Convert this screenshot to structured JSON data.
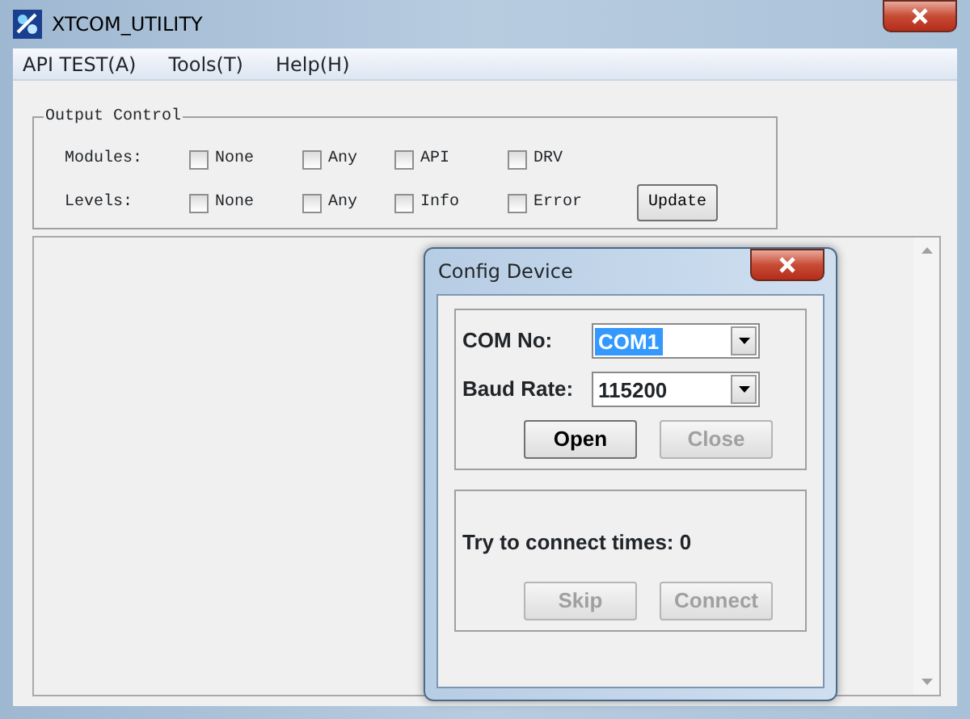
{
  "window": {
    "title": "XTCOM_UTILITY"
  },
  "menu": [
    {
      "label": "API TEST(A)"
    },
    {
      "label": "Tools(T)"
    },
    {
      "label": "Help(H)"
    }
  ],
  "output_control": {
    "title": "Output Control",
    "rows": [
      {
        "label": "Modules:",
        "options": [
          {
            "label": "None",
            "checked": false
          },
          {
            "label": "Any",
            "checked": false
          },
          {
            "label": "API",
            "checked": false
          },
          {
            "label": "DRV",
            "checked": false
          }
        ]
      },
      {
        "label": "Levels:",
        "options": [
          {
            "label": "None",
            "checked": false
          },
          {
            "label": "Any",
            "checked": false
          },
          {
            "label": "Info",
            "checked": false
          },
          {
            "label": "Error",
            "checked": false
          }
        ]
      }
    ],
    "button": "Update"
  },
  "dialog": {
    "title": "Config Device",
    "fields": [
      {
        "label": "COM No:",
        "value": "COM1",
        "selected": true
      },
      {
        "label": "Baud Rate:",
        "value": "115200",
        "selected": false
      }
    ],
    "port_buttons": [
      {
        "label": "Open",
        "disabled": false
      },
      {
        "label": "Close",
        "disabled": true
      }
    ],
    "status": "Try to connect times: 0",
    "connect_buttons": [
      {
        "label": "Skip",
        "disabled": true
      },
      {
        "label": "Connect",
        "disabled": true
      }
    ]
  }
}
